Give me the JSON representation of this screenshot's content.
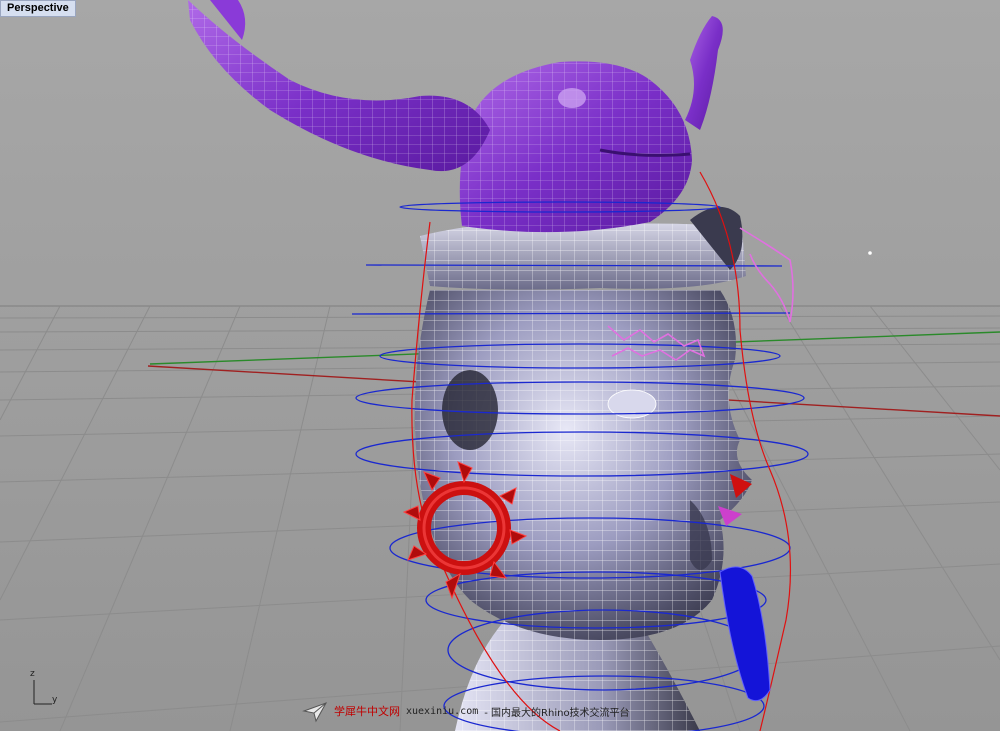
{
  "viewport": {
    "label": "Perspective",
    "axis_icon": {
      "icon": "world-axes-icon",
      "z_label": "z",
      "y_label": "y"
    },
    "colors": {
      "background": "#9c9c9c",
      "grid": "#8a8a8a",
      "x_axis": "#a02020",
      "y_axis": "#2a8a2a",
      "wireframe": "#ffffff",
      "helmet_surface": "#7a55c8",
      "curve_blue": "#1a28d0",
      "earring": "#cc1010",
      "tongue": "#1010d8",
      "selection_pink": "#e070e0"
    }
  },
  "watermark": {
    "icon": "plane-logo-icon",
    "brand": "学犀牛中文网",
    "url": "xuexiniu.com",
    "tagline": "- 国内最大的Rhino技术交流平台"
  }
}
